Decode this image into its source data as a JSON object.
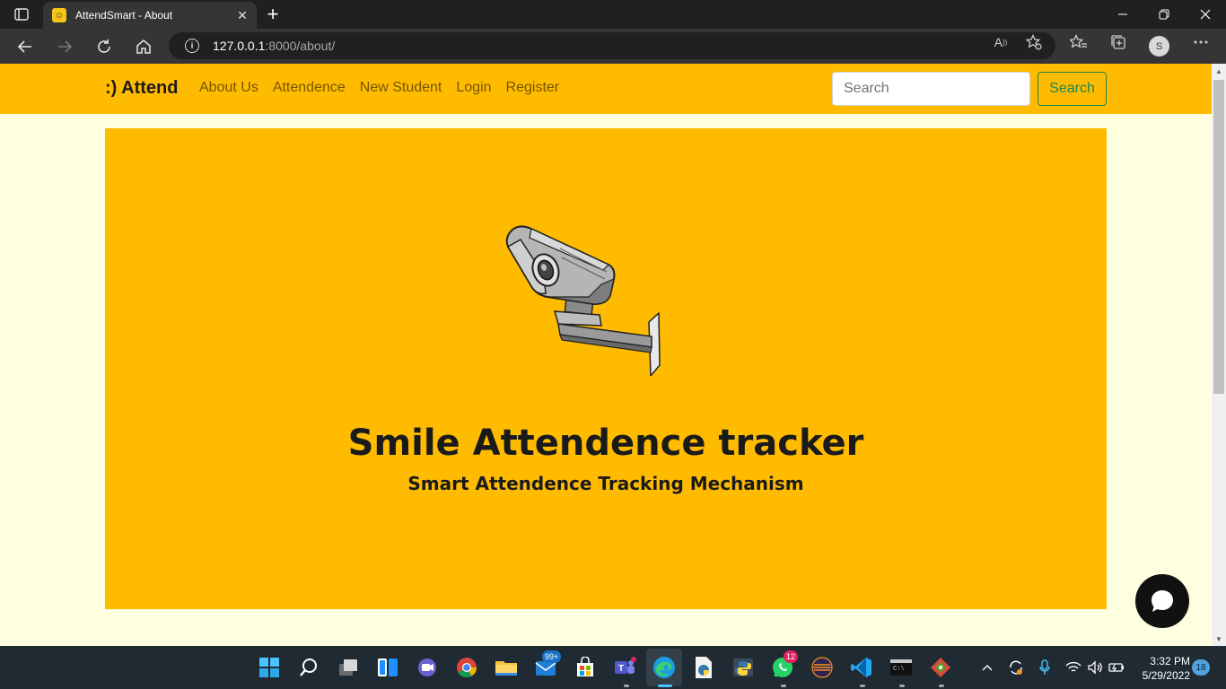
{
  "browser": {
    "tab_title": "AttendSmart - About",
    "favicon_glyph": "☺",
    "new_tab_glyph": "+",
    "close_glyph": "✕",
    "url_host": "127.0.0.1",
    "url_path": ":8000/about/",
    "profile_initial": "S"
  },
  "navbar": {
    "brand": ":) Attend",
    "links": [
      "About Us",
      "Attendence",
      "New Student",
      "Login",
      "Register"
    ],
    "search_placeholder": "Search",
    "search_button": "Search",
    "background": "#ffbb00"
  },
  "hero": {
    "title": "Smile Attendence tracker",
    "subtitle": "Smart Attendence Tracking Mechanism",
    "image": "security-camera-illustration"
  },
  "taskbar": {
    "mail_badge": "99+",
    "whatsapp_badge": "12",
    "time": "3:32 PM",
    "date": "5/29/2022",
    "notifications": "18"
  },
  "colors": {
    "page_bg": "#fefee0",
    "accent": "#ffbb00",
    "button_outline": "#198754"
  }
}
